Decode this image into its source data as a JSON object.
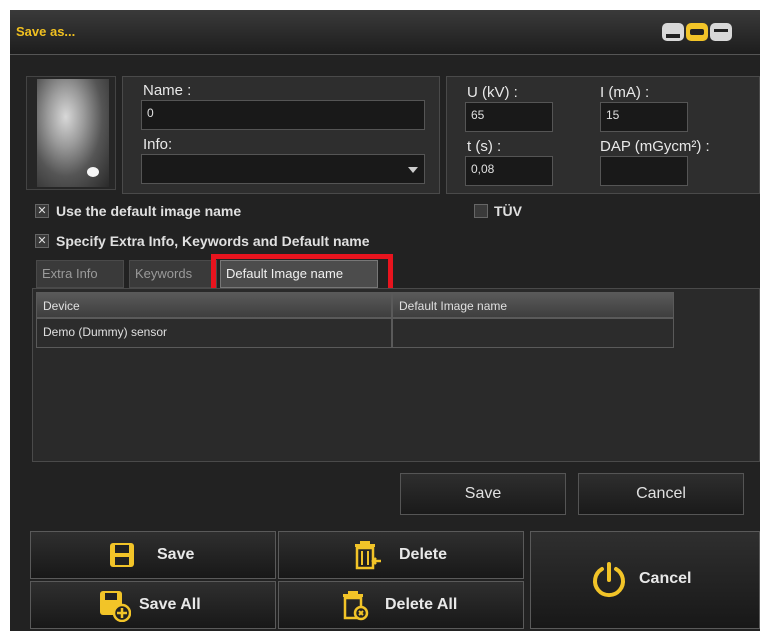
{
  "window": {
    "title": "Save as..."
  },
  "form": {
    "name_label": "Name :",
    "name_value": "0",
    "info_label": "Info:",
    "info_value": "",
    "u_label": "U (kV) :",
    "u_value": "65",
    "i_label": "I (mA) :",
    "i_value": "15",
    "t_label": "t (s) :",
    "t_value": "0,08",
    "dap_label": "DAP (mGycm²) :",
    "dap_value": ""
  },
  "checkboxes": {
    "default_name_label": "Use the default image name",
    "default_name_checked": "✕",
    "tuv_label": "TÜV",
    "extra_label": "Specify Extra Info, Keywords and Default name",
    "extra_checked": "✕"
  },
  "tabs": [
    {
      "label": "Extra Info"
    },
    {
      "label": "Keywords"
    },
    {
      "label": "Default Image name"
    }
  ],
  "table": {
    "columns": [
      "Device",
      "Default Image name"
    ],
    "rows": [
      [
        "Demo (Dummy) sensor",
        ""
      ]
    ]
  },
  "dialog_buttons": {
    "save": "Save",
    "cancel": "Cancel"
  },
  "actions": {
    "save": "Save",
    "save_all": "Save All",
    "delete": "Delete",
    "delete_all": "Delete All",
    "cancel": "Cancel"
  },
  "colors": {
    "accent": "#f2c428",
    "highlight": "#e8141e"
  },
  "icons": {
    "save": "floppy-disk-icon",
    "save_all": "floppy-plus-icon",
    "delete": "trash-icon",
    "delete_all": "trash-all-icon",
    "cancel": "power-icon"
  }
}
